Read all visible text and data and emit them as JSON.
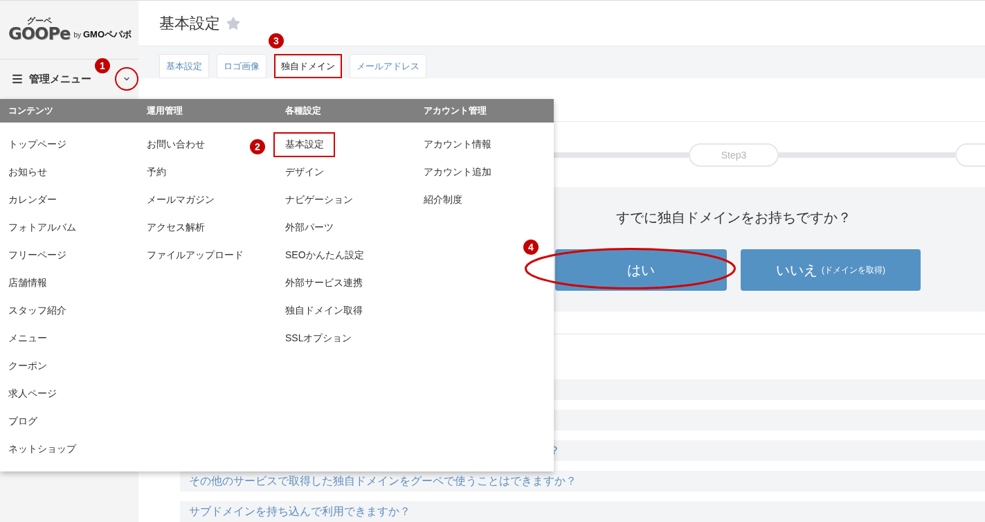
{
  "sidebar": {
    "logo": {
      "kana": "グーペ",
      "wordmark": "GOOPe",
      "byline": "by",
      "company": "GMOペパボ"
    },
    "menu_toggle": {
      "label": "管理メニュー",
      "expanded": true,
      "annotation": "1"
    }
  },
  "header": {
    "title": "基本設定",
    "starred": false
  },
  "tabs": [
    {
      "label": "基本設定",
      "selected": false
    },
    {
      "label": "ロゴ画像",
      "selected": false
    },
    {
      "label": "独自ドメイン",
      "selected": true,
      "annotation": "3"
    },
    {
      "label": "メールアドレス",
      "selected": false
    }
  ],
  "steps": [
    {
      "label": "Step3"
    }
  ],
  "domain_question": {
    "question": "すでに独自ドメインをお持ちですか？",
    "buttons": [
      {
        "label": "はい",
        "annotation": "4"
      },
      {
        "label": "いいえ",
        "note": "(ドメインを取得)"
      }
    ]
  },
  "faq": [
    {
      "kind": "covered"
    },
    {
      "kind": "covered"
    },
    {
      "kind": "cut",
      "question": "？"
    },
    {
      "kind": "full",
      "question": "その他のサービスで取得した独自ドメインをグーペで使うことはできますか？"
    },
    {
      "kind": "full",
      "question": "サブドメインを持ち込んで利用できますか？"
    }
  ],
  "dropdown_menu": {
    "columns": [
      {
        "heading": "コンテンツ",
        "items": [
          {
            "label": "トップページ"
          },
          {
            "label": "お知らせ"
          },
          {
            "label": "カレンダー"
          },
          {
            "label": "フォトアルバム"
          },
          {
            "label": "フリーページ"
          },
          {
            "label": "店舗情報"
          },
          {
            "label": "スタッフ紹介"
          },
          {
            "label": "メニュー"
          },
          {
            "label": "クーポン"
          },
          {
            "label": "求人ページ"
          },
          {
            "label": "ブログ"
          },
          {
            "label": "ネットショップ"
          }
        ]
      },
      {
        "heading": "運用管理",
        "items": [
          {
            "label": "お問い合わせ"
          },
          {
            "label": "予約"
          },
          {
            "label": "メールマガジン"
          },
          {
            "label": "アクセス解析"
          },
          {
            "label": "ファイルアップロード"
          }
        ]
      },
      {
        "heading": "各種設定",
        "items": [
          {
            "label": "基本設定",
            "annotation": "2"
          },
          {
            "label": "デザイン"
          },
          {
            "label": "ナビゲーション"
          },
          {
            "label": "外部パーツ"
          },
          {
            "label": "SEOかんたん設定"
          },
          {
            "label": "外部サービス連携"
          },
          {
            "label": "独自ドメイン取得"
          },
          {
            "label": "SSLオプション"
          }
        ]
      },
      {
        "heading": "アカウント管理",
        "items": [
          {
            "label": "アカウント情報"
          },
          {
            "label": "アカウント追加"
          },
          {
            "label": "紹介制度"
          }
        ]
      }
    ]
  }
}
